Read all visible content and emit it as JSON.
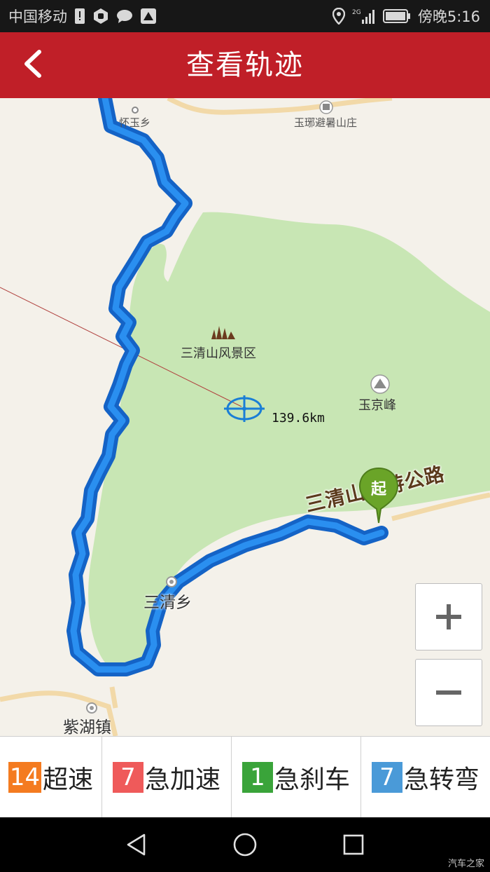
{
  "status_bar": {
    "carrier": "中国移动",
    "network": "2G",
    "time": "傍晚5:16"
  },
  "header": {
    "title": "查看轨迹",
    "back_icon": "chevron-left-icon"
  },
  "map": {
    "labels": {
      "huaiyu": "怀玉乡",
      "yulang": "玉琊避暑山庄",
      "scenic": "三清山风景区",
      "peak": "玉京峰",
      "distance": "139.6km",
      "road": "三清山旅游公路",
      "sanqing_town": "三清乡",
      "zihu_town": "紫湖镇"
    },
    "start_marker": "起",
    "zoom_in": "+",
    "zoom_out": "−"
  },
  "stats": [
    {
      "count": "14",
      "label": "超速",
      "color": "#f47b20"
    },
    {
      "count": "7",
      "label": "急加速",
      "color": "#ef5a5a"
    },
    {
      "count": "1",
      "label": "急刹车",
      "color": "#3aa43a"
    },
    {
      "count": "7",
      "label": "急转弯",
      "color": "#4a9ad8"
    }
  ],
  "colors": {
    "header": "#c01f28",
    "track": "#1a7ed6",
    "park": "#c8e6b4"
  },
  "watermark": "汽车之家"
}
